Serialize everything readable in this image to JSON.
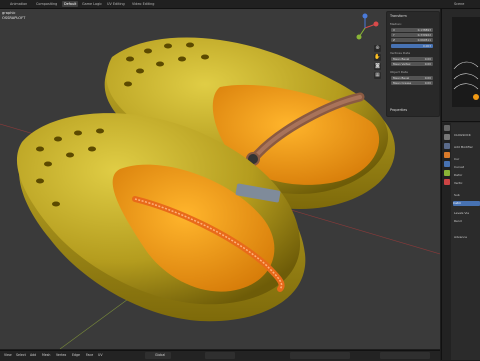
{
  "top_tabs": [
    "Animation",
    "Compositing",
    "Default",
    "Game Logic",
    "UV Editing",
    "Video Editing"
  ],
  "scene_label": "Scene",
  "viewport": {
    "info_lines": [
      "graphic",
      "OSSRAPLOFT"
    ],
    "npanel": {
      "section_dimension": "Transform",
      "label_median": "Median:",
      "coords": [
        {
          "axis": "X",
          "value": "0.138893"
        },
        {
          "axis": "Y",
          "value": "0.330922"
        },
        {
          "axis": "Z",
          "value": "0.060511"
        }
      ],
      "global_value": "0.003",
      "section_vertex": "Vertices Data",
      "mean_bevel_label": "Mean Bevel",
      "mean_bevel_value": "0.00",
      "mean_vertex_label": "Mean Vertex",
      "mean_vertex_value": "0.00",
      "section_object": "Object Data",
      "mean_bevel2_label": "Mean Bevel",
      "mean_bevel2_value": "0.00",
      "mean_crease_label": "Mean Crease",
      "mean_crease_value": "0.00",
      "properties_label": "Properties"
    }
  },
  "right_panel": {
    "object_name": "CLOGSOCK",
    "add_modifier": "Add Modifier",
    "labels": [
      "Cur",
      "Curvat",
      "Defor",
      "Vertic"
    ],
    "subdiv_label": "Sub",
    "blue_btn": "Catm",
    "levels_label": "Levels Vie",
    "render_label": "Rend",
    "advanced_label": "Advance"
  },
  "statusbar": {
    "items": [
      "View",
      "Select",
      "Add",
      "Mesh",
      "Vertex",
      "Edge",
      "Face",
      "UV"
    ],
    "transform_orientation": "Global"
  },
  "colors": {
    "viewport_bg": "#3a3a3a",
    "shoe_outer": "#b8a322",
    "shoe_inner": "#f29a14",
    "strap": "#8a5a42",
    "accent_blue": "#4772b3"
  }
}
